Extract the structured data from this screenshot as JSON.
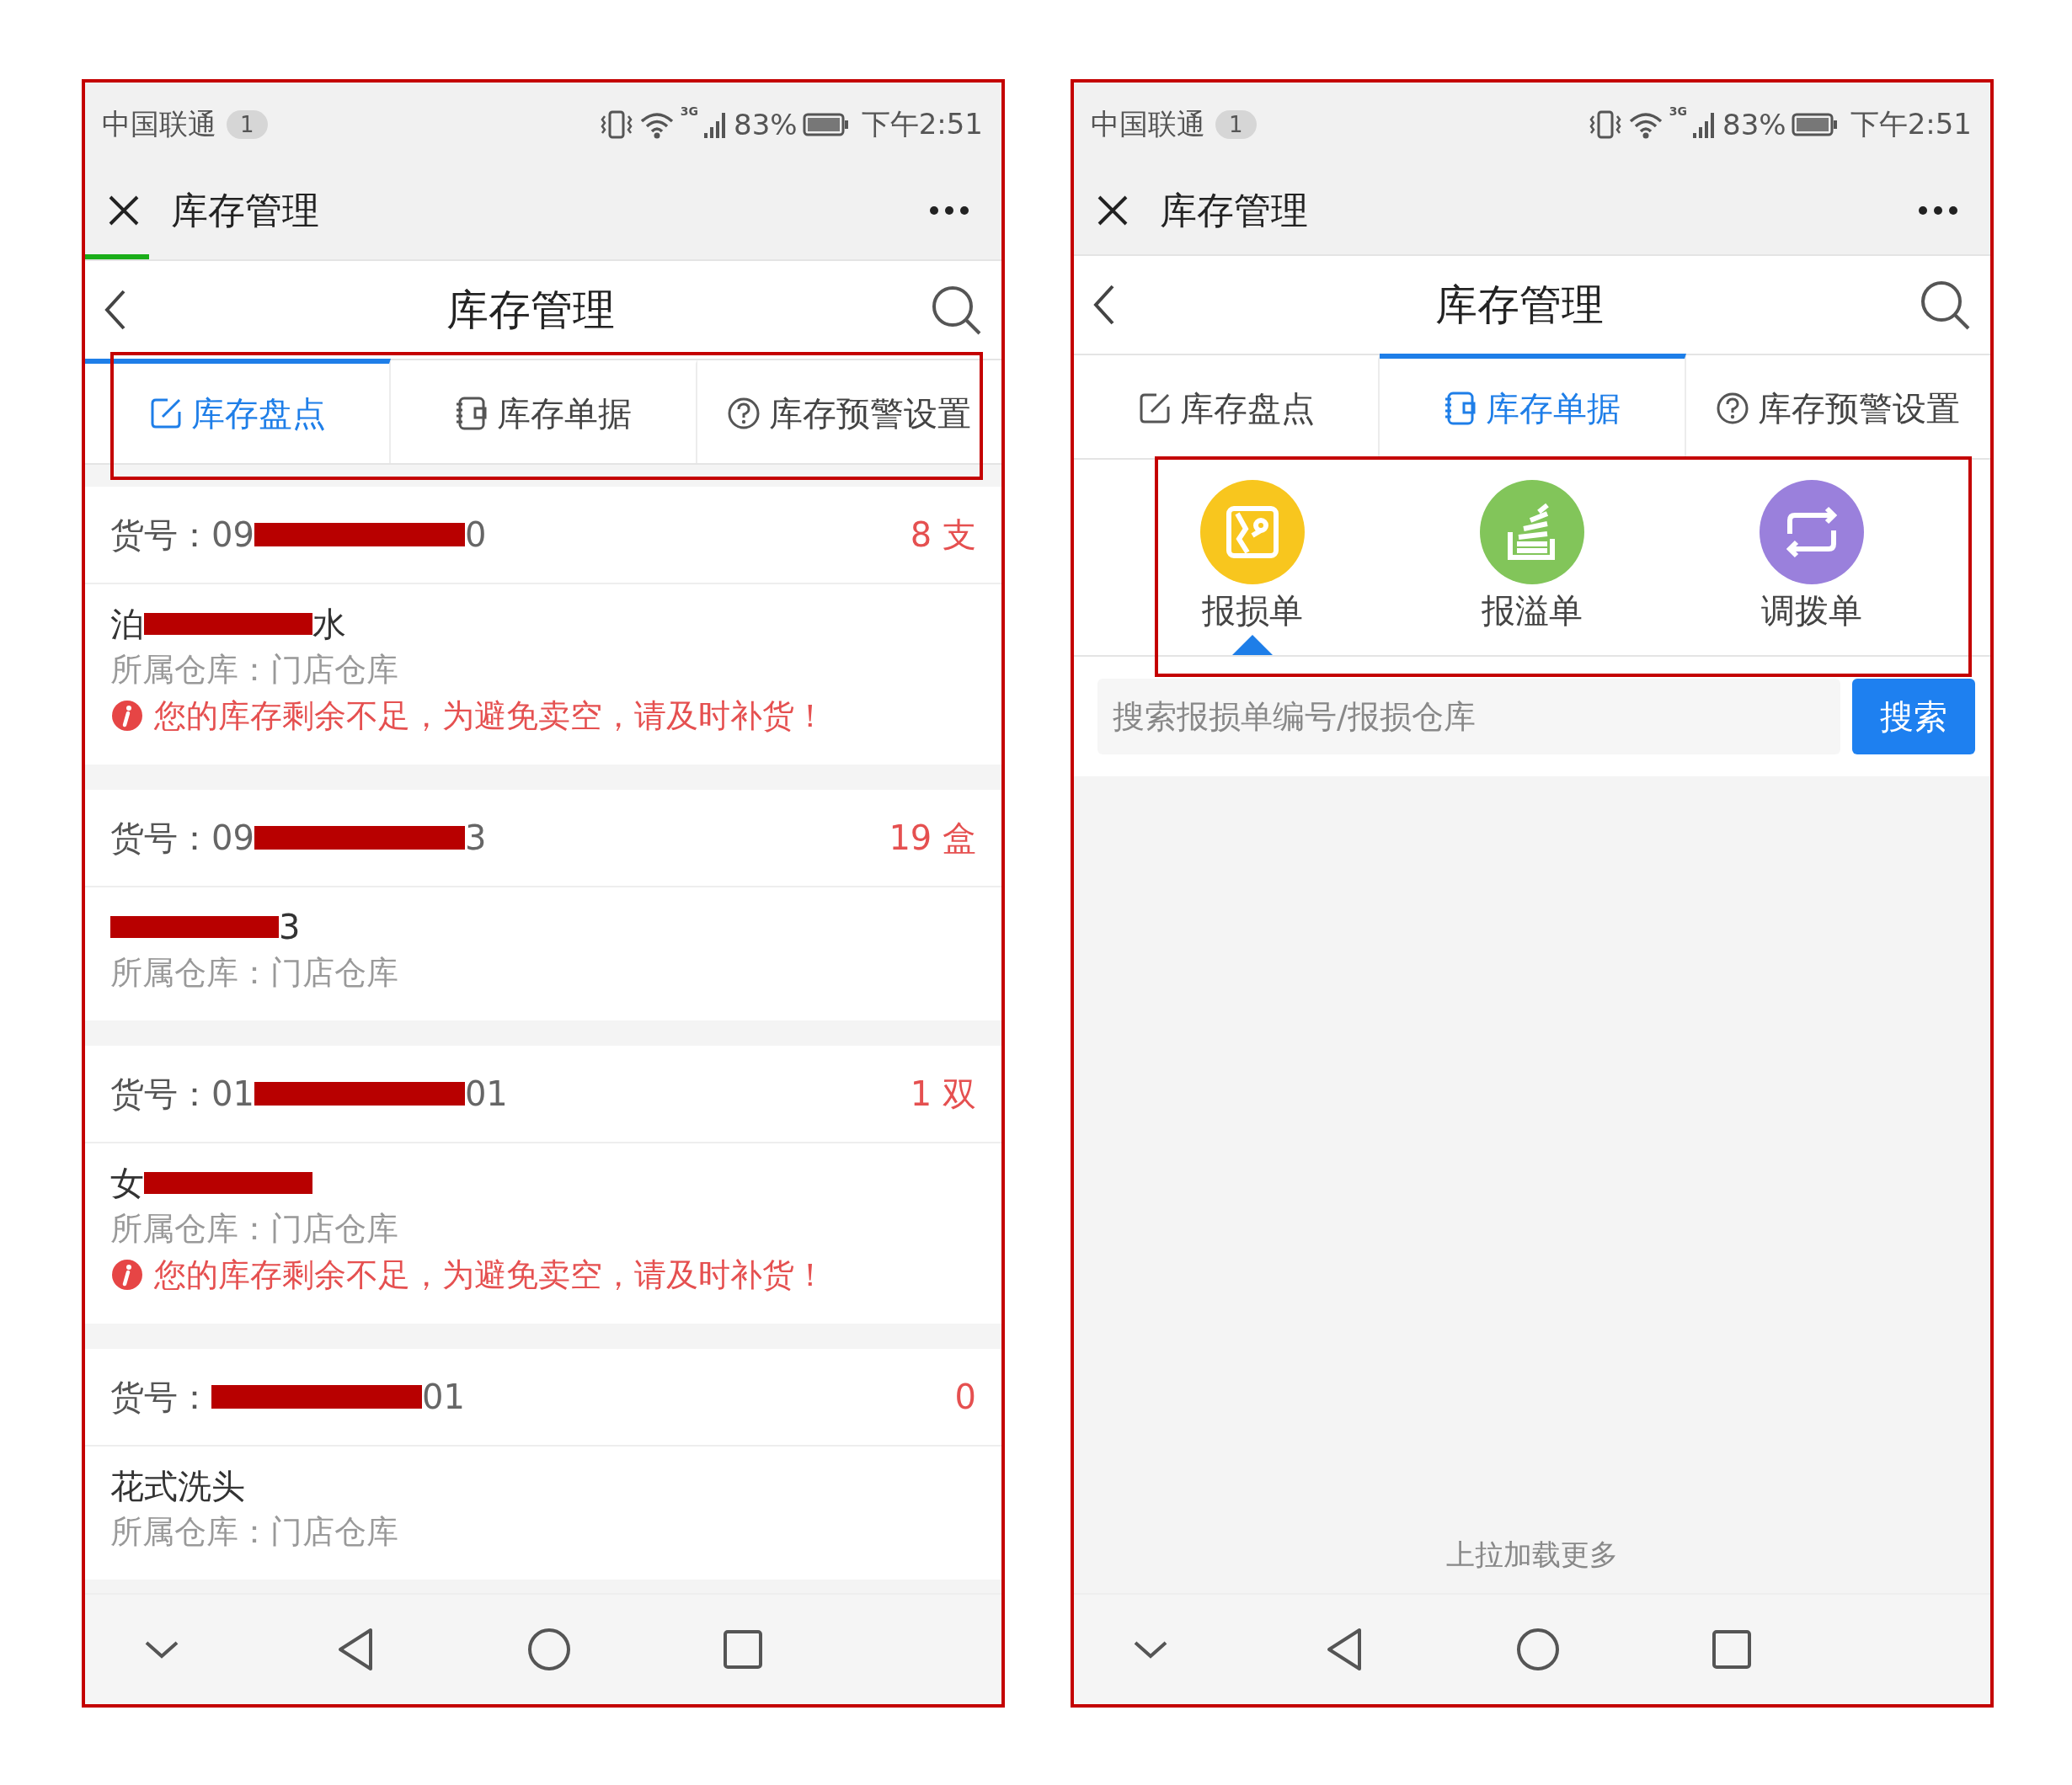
{
  "phones": [
    {
      "status_bar": {
        "carrier": "中国联通",
        "badge": "1",
        "network": "3G",
        "battery": "83%",
        "time": "下午2:51"
      },
      "app_bar": {
        "title": "库存管理"
      },
      "progress": {
        "level": 0.07
      },
      "nav": {
        "title": "库存管理"
      },
      "tabs": {
        "highlight": true,
        "items": [
          {
            "label": "库存盘点",
            "kind": "count",
            "selected": true
          },
          {
            "label": "库存单据",
            "kind": "documents",
            "selected": false
          },
          {
            "label": "库存预警设置",
            "kind": "alert",
            "selected": false
          }
        ]
      },
      "content": {
        "kind": "stock_list",
        "items": [
          {
            "code_label": "货号：",
            "code": {
              "before": "09",
              "after": "0",
              "redacted": true
            },
            "quantity": "8 支",
            "name": {
              "before": "泊",
              "after": "水",
              "redacted": true
            },
            "warehouse": "所属仓库：门店仓库",
            "warning": "您的库存剩余不足，为避免卖空，请及时补货！"
          },
          {
            "code_label": "货号：",
            "code": {
              "before": "09",
              "after": "3",
              "redacted": true
            },
            "quantity": "19 盒",
            "name": {
              "after": "3",
              "redacted": true
            },
            "warehouse": "所属仓库：门店仓库"
          },
          {
            "code_label": "货号：",
            "code": {
              "before": "01",
              "after": "01",
              "redacted": true
            },
            "quantity": "1 双",
            "name": {
              "before": "女",
              "redacted": true
            },
            "warehouse": "所属仓库：门店仓库",
            "warning": "您的库存剩余不足，为避免卖空，请及时补货！"
          },
          {
            "code_label": "货号：",
            "code": {
              "after": "01",
              "redacted": true
            },
            "quantity": "0",
            "name": {
              "before": "花式洗头",
              "redacted": false
            },
            "warehouse": "所属仓库：门店仓库"
          }
        ]
      }
    },
    {
      "status_bar": {
        "carrier": "中国联通",
        "badge": "1",
        "network": "3G",
        "battery": "83%",
        "time": "下午2:51"
      },
      "app_bar": {
        "title": "库存管理"
      },
      "nav": {
        "title": "库存管理"
      },
      "tabs": {
        "highlight": false,
        "items": [
          {
            "label": "库存盘点",
            "kind": "count",
            "selected": false
          },
          {
            "label": "库存单据",
            "kind": "documents",
            "selected": true
          },
          {
            "label": "库存预警设置",
            "kind": "alert",
            "selected": false
          }
        ]
      },
      "content": {
        "kind": "documents",
        "doc_types": {
          "highlight": true,
          "items": [
            {
              "label": "报损单",
              "kind": "damage",
              "color": "#f8c61e",
              "selected": true
            },
            {
              "label": "报溢单",
              "kind": "overflow",
              "color": "#82c55a",
              "selected": false
            },
            {
              "label": "调拨单",
              "kind": "transfer",
              "color": "#9a80dc",
              "selected": false
            }
          ]
        },
        "search": {
          "placeholder": "搜索报损单编号/报损仓库",
          "button": "搜索"
        },
        "load_more": "上拉加载更多"
      }
    }
  ]
}
